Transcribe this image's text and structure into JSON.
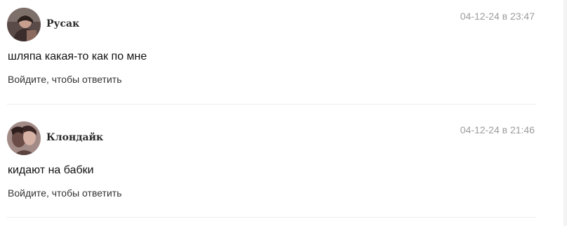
{
  "comments": [
    {
      "author": "Русак",
      "date": "04-12-24 в 23:47",
      "text": "шляпа какая-то как по мне",
      "reply_label": "Войдите, чтобы ответить",
      "avatar_icon": "user-photo-icon"
    },
    {
      "author": "Клондайк",
      "date": "04-12-24 в 21:46",
      "text": "кидают на бабки",
      "reply_label": "Войдите, чтобы ответить",
      "avatar_icon": "user-photo-icon"
    }
  ]
}
